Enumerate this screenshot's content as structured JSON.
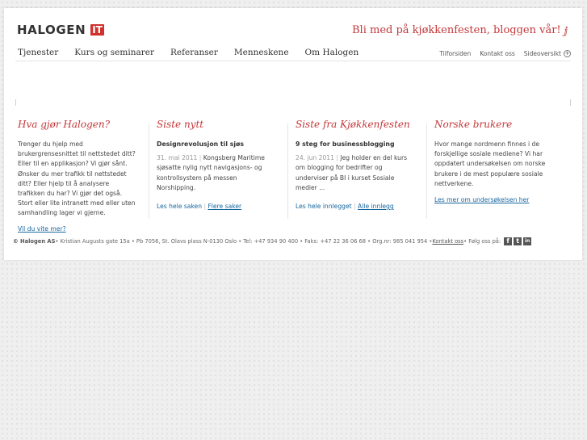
{
  "header": {
    "logo_text": "HALOGEN",
    "logo_mark": "IT",
    "tagline": "Bli med på kjøkkenfesten, bloggen vår!"
  },
  "nav": {
    "items": [
      "Tjenester",
      "Kurs og seminarer",
      "Referanser",
      "Menneskene",
      "Om Halogen"
    ],
    "utility": [
      "Tilforsiden",
      "Kontakt oss",
      "Sideoversikt"
    ]
  },
  "columns": [
    {
      "heading": "Hva gjør Halogen?",
      "body": "Trenger du hjelp med brukergrensesnittet til nettstedet ditt? Eller til en applikasjon? Vi gjør sånt.\nØnsker du mer trafikk til nettstedet ditt? Eller hjelp til å analysere trafikken du har? Vi gjør det også. Stort eller lite intranett med eller uten samhandling lager vi gjerne.",
      "link": "Vil du vite mer?"
    },
    {
      "heading": "Siste nytt",
      "item_title": "Designrevolusjon til sjøs",
      "date": "31. mai 2011",
      "body": "Kongsberg Maritime sjøsatte nylig nytt navigasjons- og kontrollsystem på messen Norshipping.",
      "link1": "Les hele saken",
      "link2": "Flere saker"
    },
    {
      "heading": "Siste fra Kjøkkenfesten",
      "item_title": "9 steg for businessblogging",
      "date": "24. jun 2011",
      "body": "Jeg holder en del kurs om blogging for bedrifter og underviser på BI i kurset Sosiale medier ...",
      "link1": "Les hele innlegget",
      "link2": "Alle innlegg"
    },
    {
      "heading": "Norske brukere",
      "body": "Hvor mange nordmenn finnes i de forskjellige sosiale mediene? Vi har oppdatert undersøkelsen om norske brukere i de mest populære sosiale nettverkene.",
      "link": "Les mer om undersøkelsen her"
    }
  ],
  "footer": {
    "company": "© Halogen AS",
    "address": " • Kristian Augusts gate 15a • Pb 7056, St. Olavs plass N-0130 Oslo • Tel: +47 934 90 400 • Faks: +47 22 36 06 68 • Org.nr: 985 041 954 • ",
    "contact_link": "Kontakt oss",
    "follow": " • Følg oss på:",
    "social": [
      "f",
      "t",
      "in"
    ]
  },
  "colors": {
    "accent_red": "#c3373a",
    "link_blue": "#16669e"
  },
  "icons": {
    "sitemap": "plus-circle-icon",
    "tagline": "spoon-icon"
  }
}
